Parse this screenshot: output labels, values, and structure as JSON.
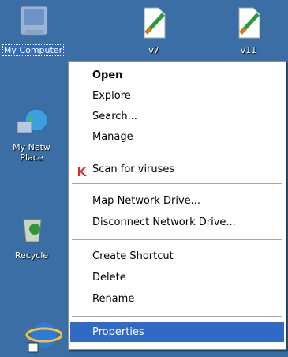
{
  "desktop": {
    "icons": [
      {
        "label": "My Computer",
        "icon": "my-computer-icon"
      },
      {
        "label": "v7",
        "icon": "image-file-icon"
      },
      {
        "label": "v11",
        "icon": "image-file-icon"
      },
      {
        "label": "My Netw Place",
        "icon": "network-places-icon"
      },
      {
        "label": "Recycle",
        "icon": "recycle-bin-icon"
      },
      {
        "label": "",
        "icon": "internet-explorer-icon"
      }
    ]
  },
  "context_menu": {
    "items": [
      {
        "label": "Open",
        "bold": true
      },
      {
        "label": "Explore"
      },
      {
        "label": "Search..."
      },
      {
        "label": "Manage"
      },
      {
        "label": "Scan for viruses",
        "icon": "kaspersky-k-icon"
      },
      {
        "label": "Map Network Drive..."
      },
      {
        "label": "Disconnect Network Drive..."
      },
      {
        "label": "Create Shortcut"
      },
      {
        "label": "Delete"
      },
      {
        "label": "Rename"
      },
      {
        "label": "Properties",
        "highlighted": true
      }
    ]
  },
  "colors": {
    "desktop": "#3a6ea5",
    "highlight": "#316ac5",
    "kaspersky": "#e0262b"
  }
}
